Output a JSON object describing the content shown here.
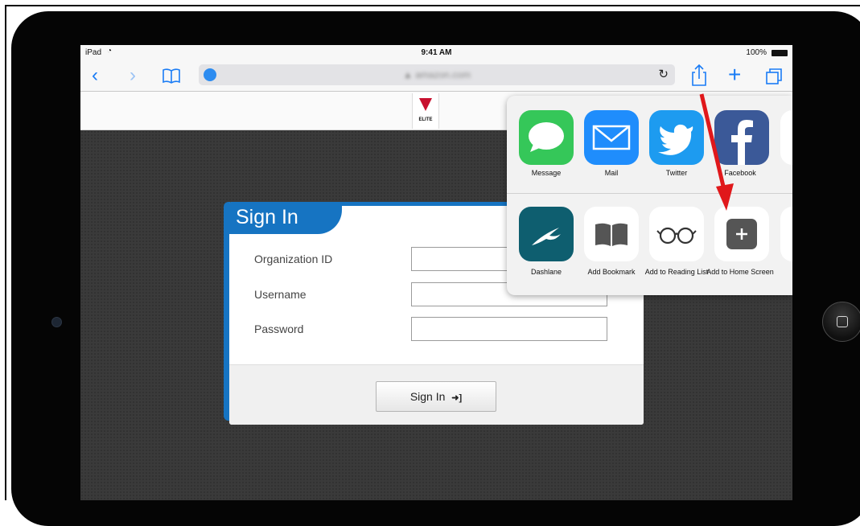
{
  "status_bar": {
    "carrier": "iPad",
    "time": "9:41 AM",
    "battery": "100%"
  },
  "safari_toolbar": {
    "url": "▲ amazon.com"
  },
  "site_header": {
    "logo_text": "ELITE"
  },
  "signin_form": {
    "title": "Sign In",
    "fields": [
      {
        "label": "Organization ID",
        "value": ""
      },
      {
        "label": "Username",
        "value": ""
      },
      {
        "label": "Password",
        "value": ""
      }
    ],
    "button_label": "Sign In",
    "button_icon": "➜]"
  },
  "share_sheet": {
    "apps": [
      {
        "label": "Message",
        "icon": "messages-icon",
        "color": "#35c759"
      },
      {
        "label": "Mail",
        "icon": "mail-icon",
        "color": "#1f8dfc"
      },
      {
        "label": "Twitter",
        "icon": "twitter-icon",
        "color": "#1d9bf0"
      },
      {
        "label": "Facebook",
        "icon": "facebook-icon",
        "color": "#3b5998"
      }
    ],
    "actions": [
      {
        "label": "Dashlane",
        "icon": "dashlane-icon",
        "color": "#0e5e6f"
      },
      {
        "label": "Add Bookmark",
        "icon": "bookmark-icon"
      },
      {
        "label": "Add to Reading List",
        "icon": "reading-list-icon"
      },
      {
        "label": "Add to Home Screen",
        "icon": "add-home-screen-icon"
      }
    ]
  },
  "colors": {
    "accent": "#1674c2",
    "annotation_arrow": "#e0181b"
  }
}
